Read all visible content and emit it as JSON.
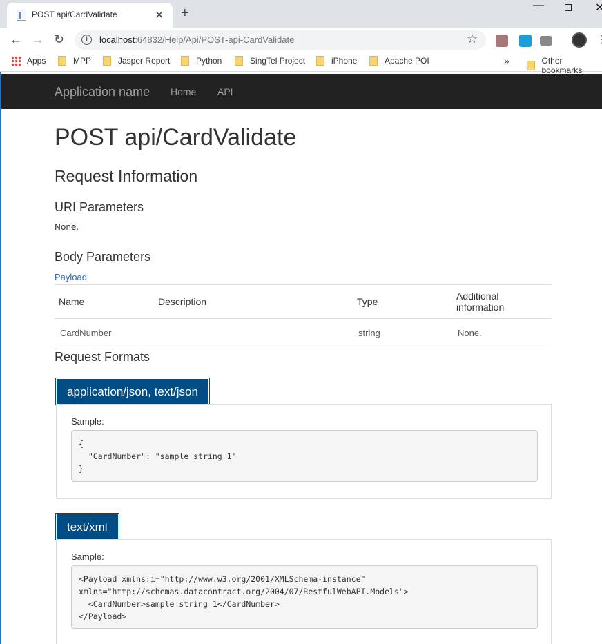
{
  "browser": {
    "tab_title": "POST api/CardValidate",
    "url_host": "localhost",
    "url_path": ":64832/Help/Api/POST-api-CardValidate",
    "bookmarks": [
      "Apps",
      "MPP",
      "Jasper Report",
      "Python",
      "SingTel Project",
      "iPhone",
      "Apache POI"
    ],
    "more_bookmarks_label": "»",
    "other_bookmarks": "Other bookmarks"
  },
  "navbar": {
    "brand": "Application name",
    "links": [
      "Home",
      "API"
    ]
  },
  "page": {
    "title": "POST api/CardValidate",
    "request_info_heading": "Request Information",
    "uri_params_heading": "URI Parameters",
    "uri_params_value": "None.",
    "body_params_heading": "Body Parameters",
    "body_params_link": "Payload",
    "table": {
      "headers": [
        "Name",
        "Description",
        "Type",
        "Additional information"
      ],
      "rows": [
        [
          "CardNumber",
          "",
          "string",
          "None."
        ]
      ]
    },
    "request_formats_heading": "Request Formats",
    "formats": [
      {
        "tab": "application/json, text/json",
        "sample_label": "Sample:",
        "code": "{\n  \"CardNumber\": \"sample string 1\"\n}"
      },
      {
        "tab": "text/xml",
        "sample_label": "Sample:",
        "code": "<Payload xmlns:i=\"http://www.w3.org/2001/XMLSchema-instance\" xmlns=\"http://schemas.datacontract.org/2004/07/RestfulWebAPI.Models\">\n  <CardNumber>sample string 1</CardNumber>\n</Payload>"
      }
    ]
  }
}
